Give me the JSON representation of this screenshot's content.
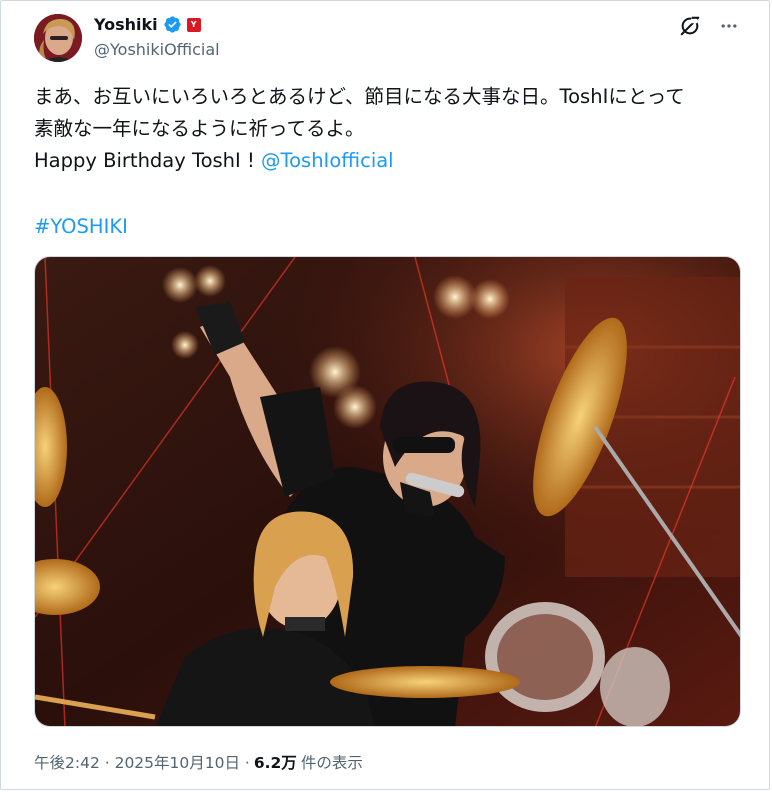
{
  "author": {
    "display_name": "Yoshiki",
    "handle": "@YoshikiOfficial",
    "verified_icon": "verified-badge-icon",
    "flag_icon": "affiliate-badge-icon"
  },
  "tweet": {
    "line1": "まあ、お互いにいろいろとあるけど、節目になる大事な日。ToshIにとって",
    "line2": "素敵な一年になるように祈ってるよ。",
    "line3_prefix": "Happy Birthday ToshI ! ",
    "mention": "@ToshIofficial",
    "hashtag": "#YOSHIKI"
  },
  "meta": {
    "time": "午後2:42 · 2025年10月10日 · ",
    "views_count": "6.2万",
    "views_label": "件の表示"
  },
  "icons": {
    "grok": "grok-icon",
    "more": "more-options-icon"
  },
  "colors": {
    "link": "#1d9bf0",
    "verified": "#1d9bf0",
    "secondary_text": "#536471"
  }
}
